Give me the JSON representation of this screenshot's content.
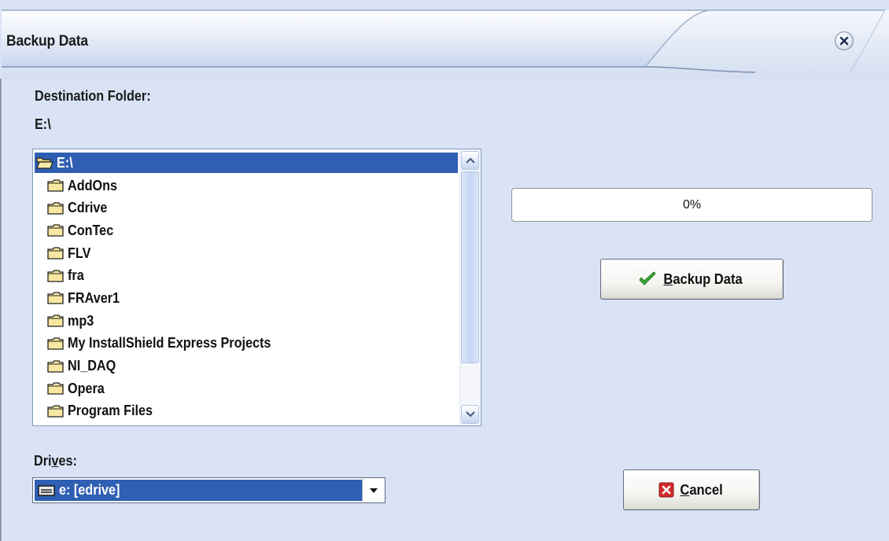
{
  "window": {
    "title": "Backup Data"
  },
  "destination": {
    "label": "Destination Folder:",
    "path": "E:\\"
  },
  "folder_tree": {
    "root": "E:\\",
    "folders": [
      "AddOns",
      "Cdrive",
      "ConTec",
      "FLV",
      "fra",
      "FRAver1",
      "mp3",
      "My InstallShield Express Projects",
      "NI_DAQ",
      "Opera",
      "Program Files"
    ]
  },
  "progress": {
    "percent": 0,
    "label": "0%"
  },
  "buttons": {
    "backup": {
      "mnemonic": "B",
      "rest": "ackup Data"
    },
    "cancel": {
      "mnemonic": "C",
      "rest": "ancel"
    }
  },
  "drives": {
    "label_pre": "Dri",
    "label_mnemonic": "v",
    "label_post": "es:",
    "selected": "e: [edrive]"
  },
  "icons": {
    "close": "close-icon",
    "folder_open": "folder-open-icon",
    "folder": "folder-icon",
    "drive": "drive-icon",
    "check": "check-icon",
    "cancel": "x-icon"
  },
  "colors": {
    "selection": "#2f5fb3",
    "background": "#d9e3f5",
    "check_green": "#3aa835",
    "cancel_red": "#d22b2b"
  }
}
